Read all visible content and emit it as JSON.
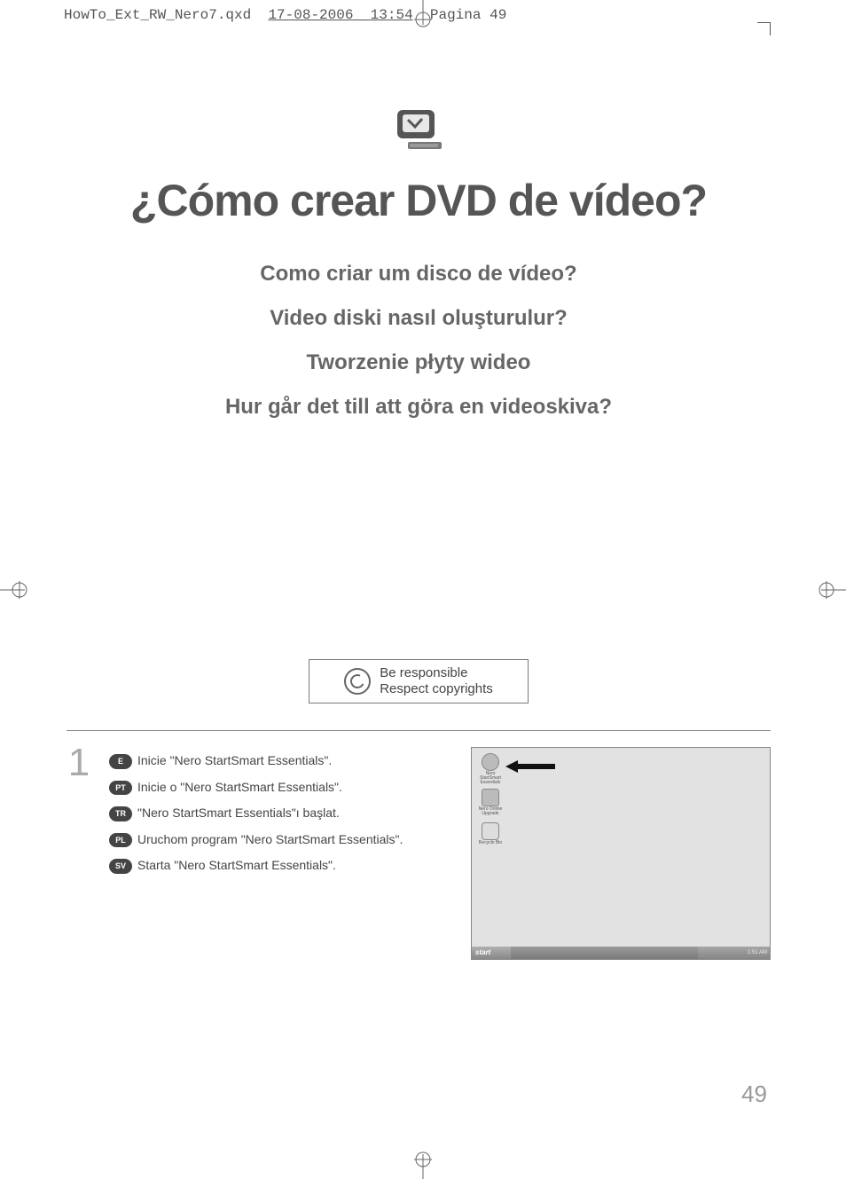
{
  "header": {
    "filename": "HowTo_Ext_RW_Nero7.qxd",
    "date": "17-08-2006",
    "time": "13:54",
    "page_label": "Pagina 49"
  },
  "title": "¿Cómo crear DVD de vídeo?",
  "subtitles": [
    "Como criar um disco de vídeo?",
    "Video diski nasıl oluşturulur?",
    "Tworzenie płyty wideo",
    "Hur går det till att göra en videoskiva?"
  ],
  "copyright": {
    "line1": "Be responsible",
    "line2": "Respect copyrights"
  },
  "step": {
    "number": "1",
    "instructions": [
      {
        "lang": "E",
        "text": "Inicie \"Nero StartSmart Essentials\"."
      },
      {
        "lang": "PT",
        "text": "Inicie o \"Nero StartSmart Essentials\"."
      },
      {
        "lang": "TR",
        "text": "\"Nero StartSmart Essentials\"ı başlat."
      },
      {
        "lang": "PL",
        "text": "Uruchom program \"Nero StartSmart Essentials\"."
      },
      {
        "lang": "SV",
        "text": "Starta \"Nero StartSmart Essentials\"."
      }
    ]
  },
  "screenshot": {
    "start": "start",
    "tray_time": "1:51 AM",
    "icons": [
      {
        "label": "Nero StartSmart Essentials"
      },
      {
        "label": "Nero Online Upgrade"
      },
      {
        "label": "Recycle Bin"
      }
    ]
  },
  "page_number": "49"
}
